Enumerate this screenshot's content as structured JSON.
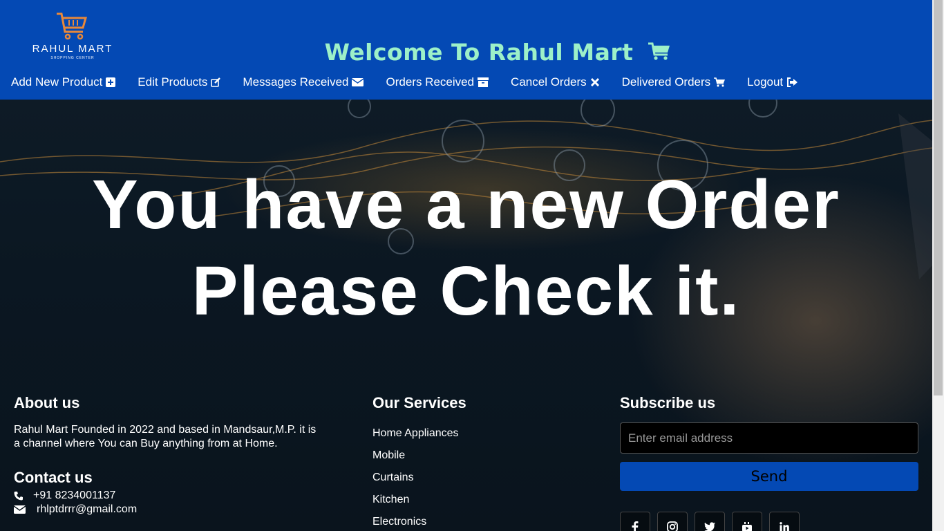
{
  "brand": {
    "name": "RAHUL MART",
    "tagline": "SHOPPING CENTER"
  },
  "header": {
    "welcome": "Welcome To Rahul Mart"
  },
  "nav": [
    {
      "label": "Add New Product",
      "icon": "plus-square-icon"
    },
    {
      "label": "Edit Products",
      "icon": "edit-icon"
    },
    {
      "label": "Messages Received",
      "icon": "envelope-icon"
    },
    {
      "label": "Orders Received",
      "icon": "archive-icon"
    },
    {
      "label": "Cancel Orders",
      "icon": "close-icon"
    },
    {
      "label": "Delivered Orders",
      "icon": "cart-icon"
    },
    {
      "label": "Logout",
      "icon": "sign-out-icon"
    }
  ],
  "hero": {
    "line1": "You have a new Order",
    "line2": "Please Check it."
  },
  "footer": {
    "about_title": "About us",
    "about_text": "Rahul Mart Founded in 2022 and based in Mandsaur,M.P. it is a channel where You can Buy anything from at Home.",
    "contact_title": "Contact us",
    "phone": "+91 8234001137",
    "email": "rhlptdrrr@gmail.com",
    "services_title": "Our Services",
    "services": [
      "Home Appliances",
      "Mobile",
      "Curtains",
      "Kitchen",
      "Electronics"
    ],
    "subscribe_title": "Subscribe us",
    "email_placeholder": "Enter email address",
    "send_label": "Send",
    "social": [
      "facebook-icon",
      "instagram-icon",
      "twitter-icon",
      "youtube-icon",
      "linkedin-icon"
    ]
  },
  "colors": {
    "header_bg": "#0449b4",
    "welcome": "#9df0c8",
    "logo_accent": "#e8883a"
  }
}
